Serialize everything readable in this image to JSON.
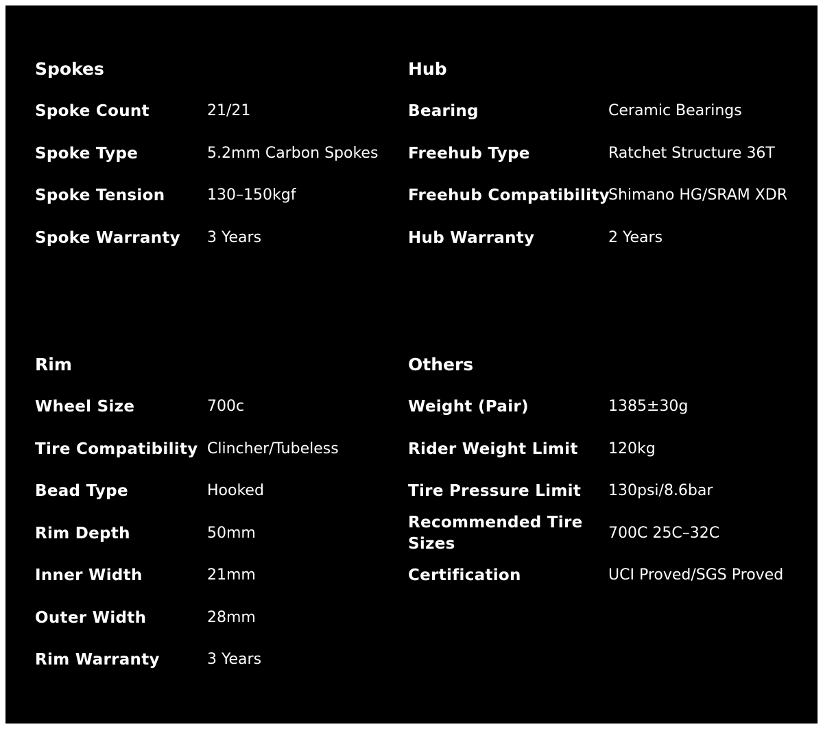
{
  "sections": [
    {
      "title": "Spokes",
      "rows": [
        {
          "label": "Spoke Count",
          "value": "21/21"
        },
        {
          "label": "Spoke Type",
          "value": "5.2mm Carbon Spokes"
        },
        {
          "label": "Spoke Tension",
          "value": "130–150kgf"
        },
        {
          "label": "Spoke Warranty",
          "value": "3 Years"
        }
      ]
    },
    {
      "title": "Hub",
      "rows": [
        {
          "label": "Bearing",
          "value": "Ceramic Bearings"
        },
        {
          "label": "Freehub Type",
          "value": "Ratchet Structure 36T"
        },
        {
          "label": "Freehub Compatibility",
          "value": "Shimano HG/SRAM XDR"
        },
        {
          "label": "Hub Warranty",
          "value": "2 Years"
        }
      ]
    },
    {
      "title": "Rim",
      "rows": [
        {
          "label": "Wheel Size",
          "value": "700c"
        },
        {
          "label": "Tire Compatibility",
          "value": "Clincher/Tubeless"
        },
        {
          "label": "Bead Type",
          "value": "Hooked"
        },
        {
          "label": "Rim Depth",
          "value": "50mm"
        },
        {
          "label": "Inner Width",
          "value": "21mm"
        },
        {
          "label": "Outer Width",
          "value": "28mm"
        },
        {
          "label": "Rim Warranty",
          "value": "3 Years"
        }
      ]
    },
    {
      "title": "Others",
      "rows": [
        {
          "label": "Weight (Pair)",
          "value": "1385±30g"
        },
        {
          "label": "Rider Weight Limit",
          "value": "120kg"
        },
        {
          "label": "Tire Pressure Limit",
          "value": "130psi/8.6bar"
        },
        {
          "label": "Recommended Tire Sizes",
          "value": "700C 25C–32C"
        },
        {
          "label": "Certification",
          "value": "UCI Proved/SGS Proved"
        }
      ]
    }
  ]
}
